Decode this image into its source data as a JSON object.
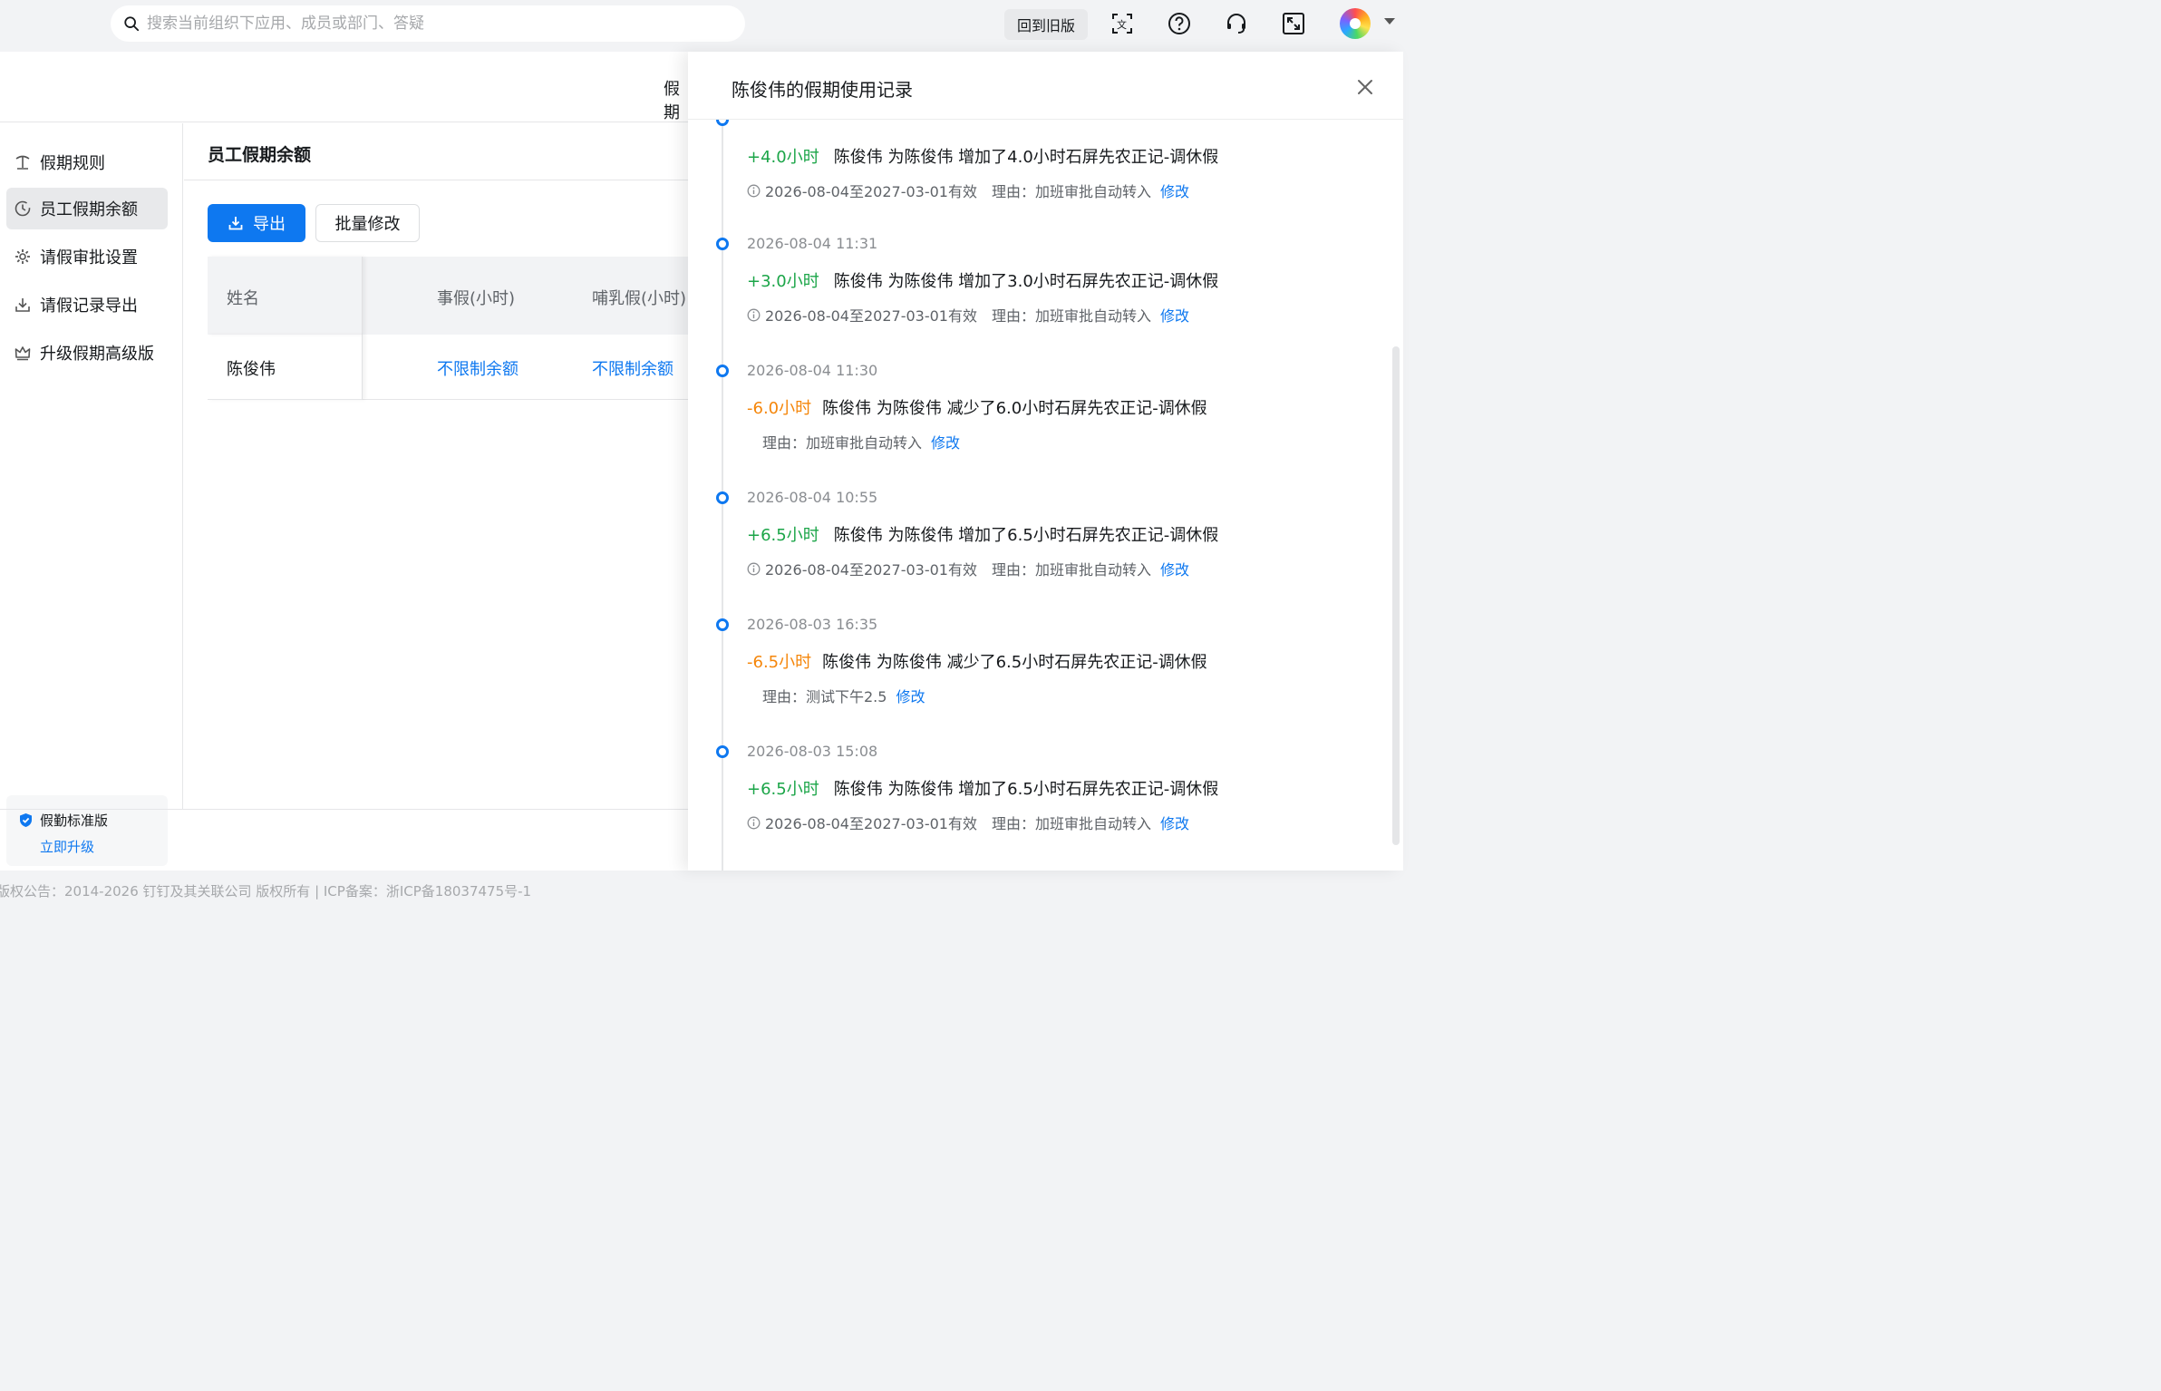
{
  "topbar": {
    "search_placeholder": "搜索当前组织下应用、成员或部门、答疑",
    "old_version_label": "回到旧版",
    "icons": [
      "translate-icon",
      "help-icon",
      "headset-icon",
      "fullscreen-icon"
    ]
  },
  "header": {
    "tab_label": "假期"
  },
  "sidebar": {
    "items": [
      {
        "label": "假期规则",
        "icon": "island-icon",
        "active": false
      },
      {
        "label": "员工假期余额",
        "icon": "clock-icon",
        "active": true
      },
      {
        "label": "请假审批设置",
        "icon": "gear-icon",
        "active": false
      },
      {
        "label": "请假记录导出",
        "icon": "download-icon",
        "active": false
      },
      {
        "label": "升级假期高级版",
        "icon": "crown-icon",
        "active": false
      }
    ],
    "plan": {
      "name": "假勤标准版",
      "upgrade_label": "立即升级"
    }
  },
  "content": {
    "title": "员工假期余额",
    "export_label": "导出",
    "batch_edit_label": "批量修改",
    "table": {
      "columns": [
        "姓名",
        "事假(小时)",
        "哺乳假(小时)"
      ],
      "rows": [
        {
          "name": "陈俊伟",
          "personal_leave": "不限制余额",
          "nursing_leave": "不限制余额"
        }
      ]
    }
  },
  "drawer": {
    "title": "陈俊伟的假期使用记录",
    "records": [
      {
        "time": "",
        "amount": "+4.0小时",
        "type": "plus",
        "text": "陈俊伟 为陈俊伟 增加了4.0小时石屏先农正记-调休假",
        "validity": "2026-08-04至2027-03-01有效",
        "reason": "理由：加班审批自动转入",
        "edit": "修改"
      },
      {
        "time": "2026-08-04 11:31",
        "amount": "+3.0小时",
        "type": "plus",
        "text": "陈俊伟 为陈俊伟 增加了3.0小时石屏先农正记-调休假",
        "validity": "2026-08-04至2027-03-01有效",
        "reason": "理由：加班审批自动转入",
        "edit": "修改"
      },
      {
        "time": "2026-08-04 11:30",
        "amount": "-6.0小时",
        "type": "minus",
        "text": "陈俊伟 为陈俊伟 减少了6.0小时石屏先农正记-调休假",
        "validity": "",
        "reason": "理由：加班审批自动转入",
        "edit": "修改"
      },
      {
        "time": "2026-08-04 10:55",
        "amount": "+6.5小时",
        "type": "plus",
        "text": "陈俊伟 为陈俊伟 增加了6.5小时石屏先农正记-调休假",
        "validity": "2026-08-04至2027-03-01有效",
        "reason": "理由：加班审批自动转入",
        "edit": "修改"
      },
      {
        "time": "2026-08-03 16:35",
        "amount": "-6.5小时",
        "type": "minus",
        "text": "陈俊伟 为陈俊伟 减少了6.5小时石屏先农正记-调休假",
        "validity": "",
        "reason": "理由：测试下午2.5",
        "edit": "修改"
      },
      {
        "time": "2026-08-03 15:08",
        "amount": "+6.5小时",
        "type": "plus",
        "text": "陈俊伟 为陈俊伟 增加了6.5小时石屏先农正记-调休假",
        "validity": "2026-08-04至2027-03-01有效",
        "reason": "理由：加班审批自动转入",
        "edit": "修改"
      }
    ]
  },
  "footer": {
    "copyright": "版权公告：2014-2026 钉钉及其关联公司 版权所有 | ICP备案：浙ICP备18037475号-1"
  },
  "colors": {
    "accent": "#0e78f0",
    "plus": "#1ba548",
    "minus": "#f5860a"
  }
}
